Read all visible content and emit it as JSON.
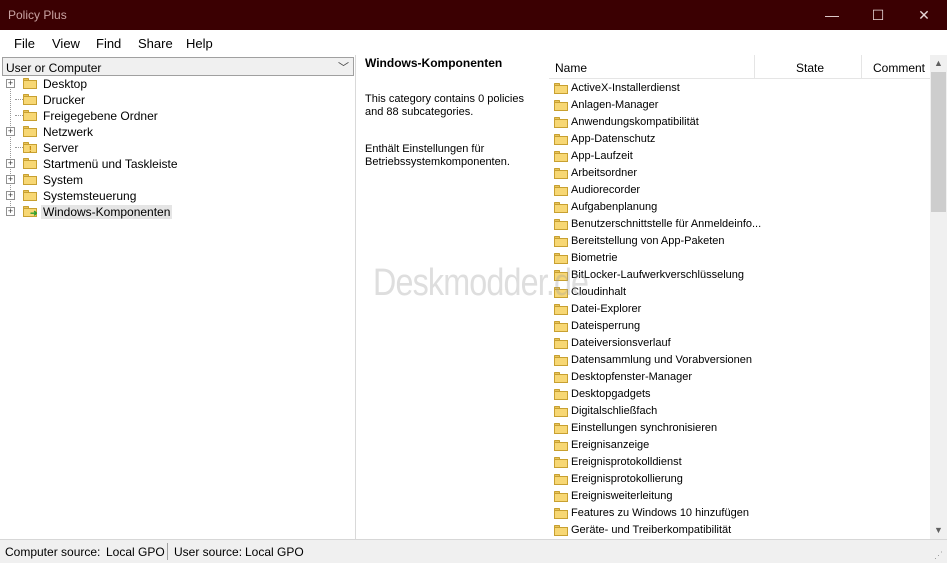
{
  "window": {
    "title": "Policy Plus",
    "minimize_glyph": "—",
    "maximize_glyph": "☐",
    "close_glyph": "✕"
  },
  "menu": [
    "File",
    "View",
    "Find",
    "Share",
    "Help"
  ],
  "scope_combo": {
    "value": "User or Computer"
  },
  "tree": [
    {
      "label": "Desktop",
      "expandable": true,
      "icon": "folder-icon"
    },
    {
      "label": "Drucker",
      "expandable": false,
      "icon": "folder-icon"
    },
    {
      "label": "Freigegebene Ordner",
      "expandable": false,
      "icon": "folder-icon"
    },
    {
      "label": "Netzwerk",
      "expandable": true,
      "icon": "folder-icon"
    },
    {
      "label": "Server",
      "expandable": false,
      "icon": "folder-warning-icon"
    },
    {
      "label": "Startmenü und Taskleiste",
      "expandable": true,
      "icon": "folder-icon"
    },
    {
      "label": "System",
      "expandable": true,
      "icon": "folder-icon"
    },
    {
      "label": "Systemsteuerung",
      "expandable": true,
      "icon": "folder-icon"
    },
    {
      "label": "Windows-Komponenten",
      "expandable": true,
      "icon": "folder-arrow-icon",
      "selected": true
    }
  ],
  "detail": {
    "title": "Windows-Komponenten",
    "summary_line1": "This category contains 0 policies",
    "summary_line2": "and 88 subcategories.",
    "desc_line1": "Enthält Einstellungen für",
    "desc_line2": "Betriebssystemkomponenten."
  },
  "list": {
    "columns": {
      "name": "Name",
      "state": "State",
      "comment": "Comment"
    },
    "items": [
      "ActiveX-Installerdienst",
      "Anlagen-Manager",
      "Anwendungskompatibilität",
      "App-Datenschutz",
      "App-Laufzeit",
      "Arbeitsordner",
      "Audiorecorder",
      "Aufgabenplanung",
      "Benutzerschnittstelle für Anmeldeinfo...",
      "Bereitstellung von App-Paketen",
      "Biometrie",
      "BitLocker-Laufwerkverschlüsselung",
      "Cloudinhalt",
      "Datei-Explorer",
      "Dateisperrung",
      "Dateiversionsverlauf",
      "Datensammlung und Vorabversionen",
      "Desktopfenster-Manager",
      "Desktopgadgets",
      "Digitalschließfach",
      "Einstellungen synchronisieren",
      "Ereignisanzeige",
      "Ereignisprotokolldienst",
      "Ereignisprotokollierung",
      "Ereignisweiterleitung",
      "Features zu Windows 10 hinzufügen",
      "Geräte- und Treiberkompatibilität"
    ]
  },
  "status": {
    "computer_label": "Computer source:",
    "computer_value": "Local GPO",
    "user_label": "User source:",
    "user_value": "Local GPO"
  },
  "watermark": "Deskmodder.de",
  "colors": {
    "titlebar": "#3b0002",
    "folder": "#f7d774"
  }
}
